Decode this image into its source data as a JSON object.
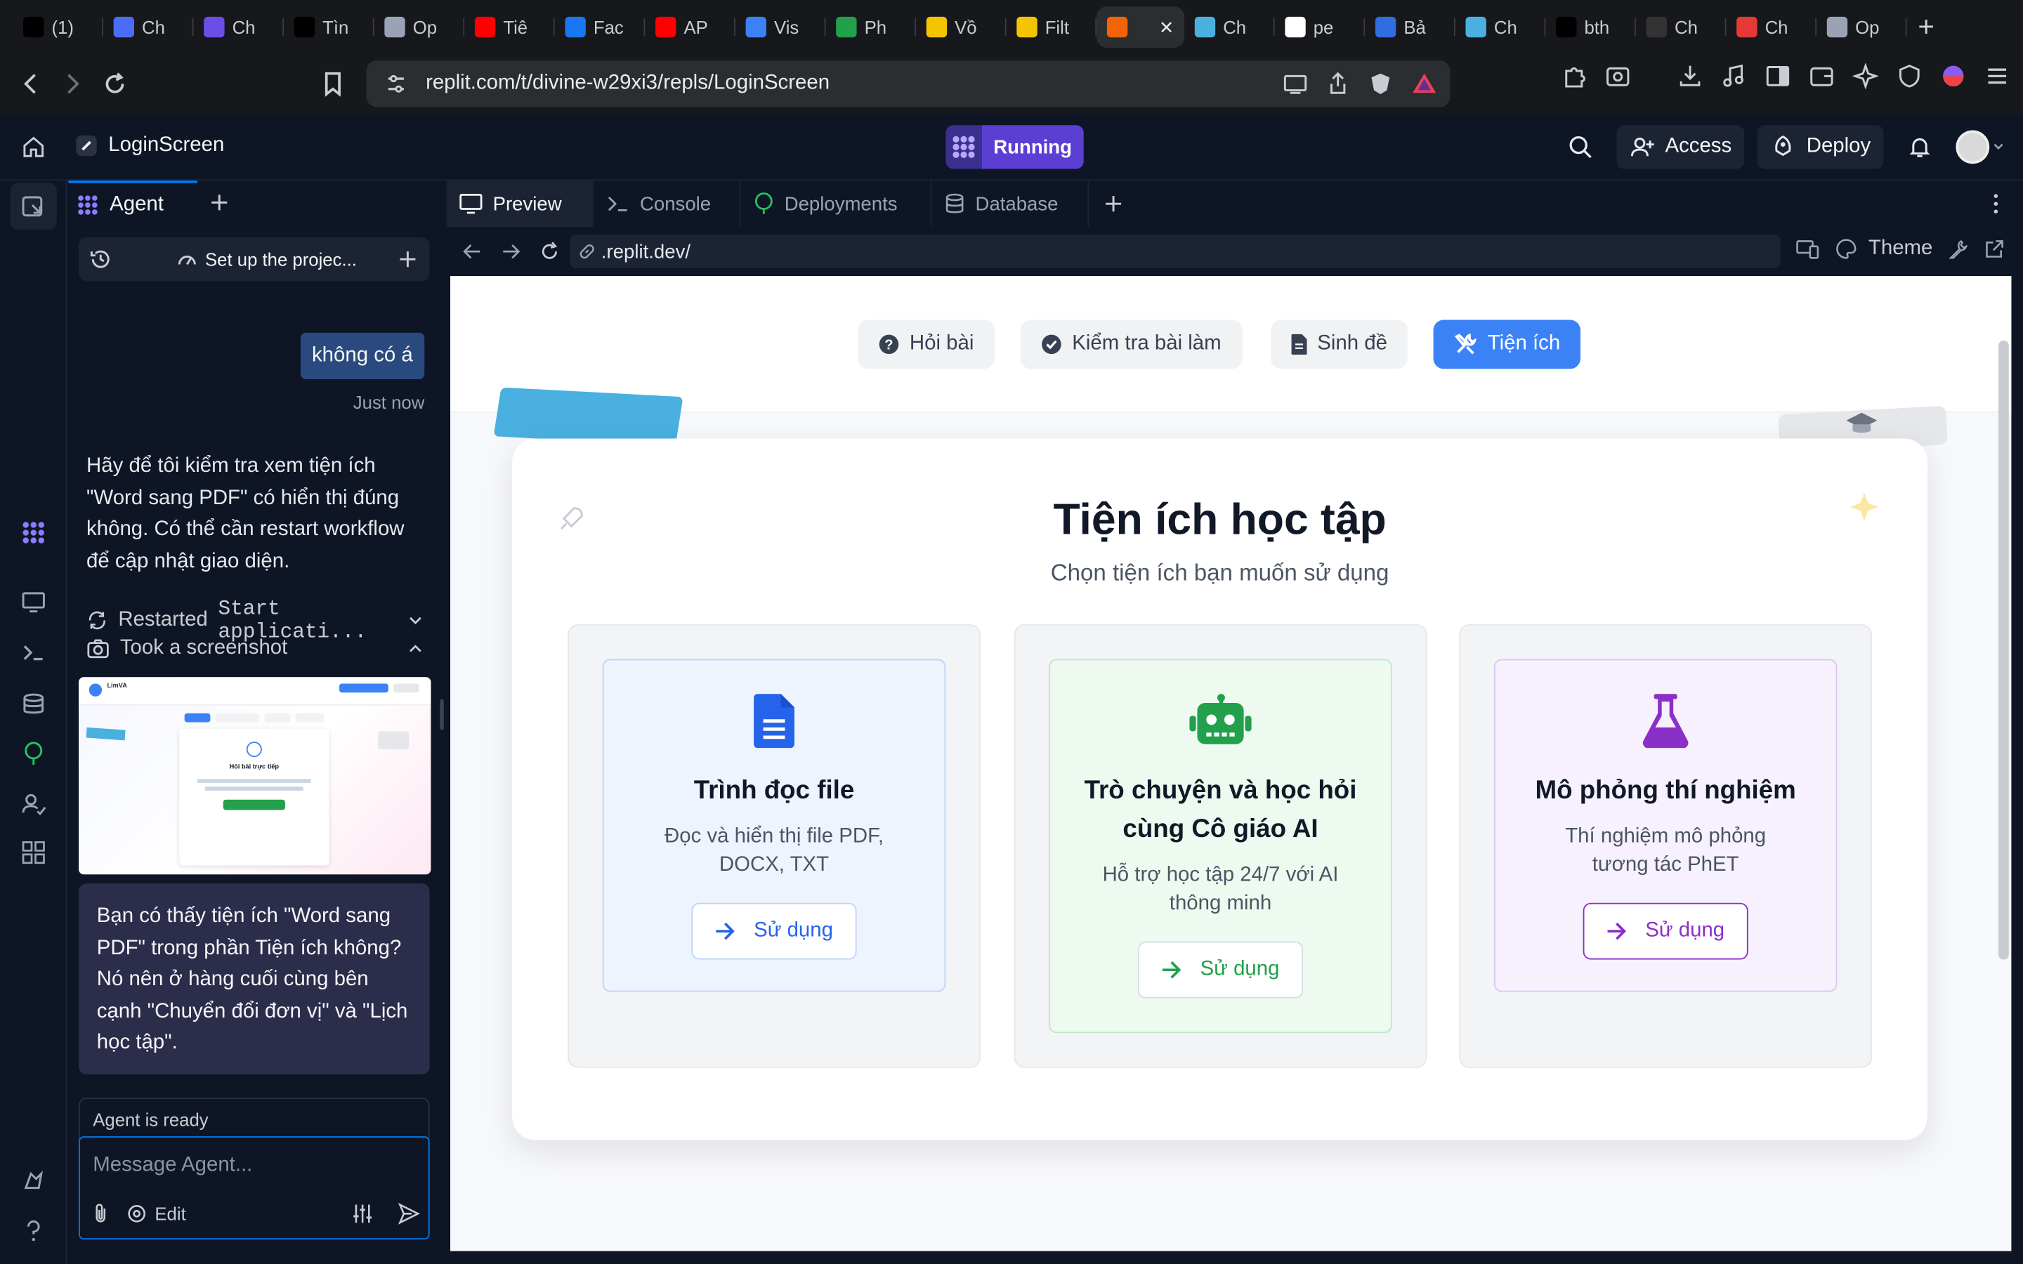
{
  "browser": {
    "tabs": [
      {
        "label": "(1)",
        "color": "#000000"
      },
      {
        "label": "Ch",
        "color": "#4a6cf7"
      },
      {
        "label": "Ch",
        "color": "#6b4ee6"
      },
      {
        "label": "Tìn",
        "color": "#000000"
      },
      {
        "label": "Op",
        "color": "#9aa3b5"
      },
      {
        "label": "Tiê",
        "color": "#ff0000"
      },
      {
        "label": "Fac",
        "color": "#1877f2"
      },
      {
        "label": "AP",
        "color": "#ff0000"
      },
      {
        "label": "Vis",
        "color": "#3b82f6"
      },
      {
        "label": "Ph",
        "color": "#22a04b"
      },
      {
        "label": "Vồ",
        "color": "#f5c400"
      },
      {
        "label": "Filt",
        "color": "#f5c400"
      },
      {
        "label": "",
        "color": "#f26207",
        "active": true
      },
      {
        "label": "Ch",
        "color": "#4ab0e0"
      },
      {
        "label": "pe",
        "color": "#ffffff"
      },
      {
        "label": "Bả",
        "color": "#2f6de1"
      },
      {
        "label": "Ch",
        "color": "#4ab0e0"
      },
      {
        "label": "bth",
        "color": "#000000"
      },
      {
        "label": "Ch",
        "color": "#333333"
      },
      {
        "label": "Ch",
        "color": "#e53935"
      },
      {
        "label": "Op",
        "color": "#9aa3b5"
      }
    ],
    "url": "replit.com/t/divine-w29xi3/repls/LoginScreen"
  },
  "header": {
    "repl_name": "LoginScreen",
    "run_label": "Running",
    "access_label": "Access",
    "deploy_label": "Deploy"
  },
  "agent": {
    "tab_label": "Agent",
    "session_title": "Set up the projec...",
    "user_message": "không có á",
    "user_time": "Just now",
    "agent_text": "Hãy để tôi kiểm tra xem tiện ích \"Word sang PDF\" có hiển thị đúng không. Có thể cần restart workflow để cập nhật giao diện.",
    "action1_prefix": "Restarted",
    "action1_code": "Start applicati...",
    "action2": "Took a screenshot",
    "agent_question": "Bạn có thấy tiện ích \"Word sang PDF\" trong phần Tiện ích không? Nó nên ở hàng cuối cùng bên cạnh \"Chuyển đổi đơn vị\" và \"Lịch học tập\".",
    "status": "Agent is ready",
    "input_placeholder": "Message Agent...",
    "edit_label": "Edit"
  },
  "workspace": {
    "tabs": [
      {
        "label": "Preview",
        "active": true
      },
      {
        "label": "Console"
      },
      {
        "label": "Deployments"
      },
      {
        "label": "Database"
      }
    ],
    "preview_url": ".replit.dev/",
    "theme_label": "Theme"
  },
  "app": {
    "nav": [
      {
        "label": "Hỏi bài"
      },
      {
        "label": "Kiểm tra bài làm"
      },
      {
        "label": "Sinh đề"
      },
      {
        "label": "Tiện ích",
        "active": true
      }
    ],
    "title": "Tiện ích học tập",
    "subtitle": "Chọn tiện ích bạn muốn sử dụng",
    "tools": [
      {
        "name": "Trình đọc file",
        "desc": "Đọc và hiển thị file PDF, DOCX, TXT",
        "button": "Sử dụng",
        "icon": "file-icon",
        "accent": "#2563eb",
        "bg": "#eef4fe",
        "border": "#bfd3f8"
      },
      {
        "name": "Trò chuyện và học hỏi cùng Cô giáo AI",
        "desc": "Hỗ trợ học tập 24/7 với AI thông minh",
        "button": "Sử dụng",
        "icon": "robot-icon",
        "accent": "#22a04b",
        "bg": "#eefaf0",
        "border": "#bfe6c8"
      },
      {
        "name": "Mô phỏng thí nghiệm",
        "desc": "Thí nghiệm mô phỏng tương tác PhET",
        "button": "Sử dụng",
        "icon": "flask-icon",
        "accent": "#8b2fc9",
        "bg": "#f6f1fd",
        "border": "#d9c6f3"
      }
    ],
    "screenshot": {
      "app_name": "LimVA",
      "heading": "Hỏi bài trực tiếp"
    }
  }
}
